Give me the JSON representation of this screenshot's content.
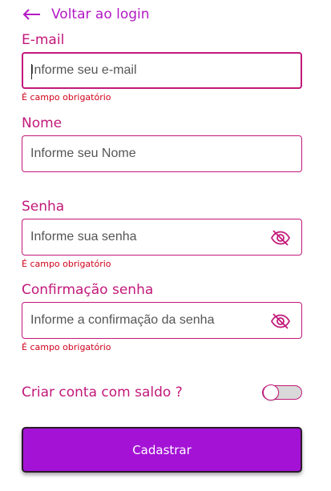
{
  "back": {
    "label": "Voltar ao login",
    "icon": "arrow-left-icon"
  },
  "form": {
    "email": {
      "label": "E-mail",
      "placeholder": "Informe seu e-mail",
      "value": "",
      "error": "É campo obrigatório"
    },
    "name": {
      "label": "Nome",
      "placeholder": "Informe seu Nome",
      "value": ""
    },
    "password": {
      "label": "Senha",
      "placeholder": "Informe sua senha",
      "value": "",
      "error": "É campo obrigatório",
      "icon": "eye-off-icon"
    },
    "confirm": {
      "label": "Confirmação senha",
      "placeholder": "Informe a confirmação da senha",
      "value": "",
      "error": "É campo obrigatório",
      "icon": "eye-off-icon"
    },
    "balance_toggle": {
      "label": "Criar conta com saldo ?",
      "on": false
    },
    "submit_label": "Cadastrar"
  },
  "colors": {
    "accent": "#c2187a",
    "link": "#b319c4",
    "error": "#d0021b",
    "button": "#a412d6"
  }
}
